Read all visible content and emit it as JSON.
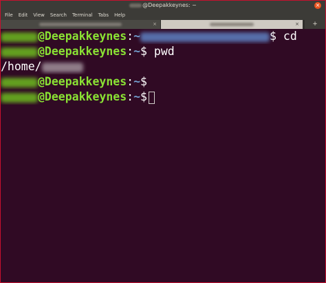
{
  "window": {
    "title_suffix": "@Deepakkeynes: ~",
    "close_glyph": "×"
  },
  "menu": {
    "items": [
      "File",
      "Edit",
      "View",
      "Search",
      "Terminal",
      "Tabs",
      "Help"
    ]
  },
  "tabs": {
    "close_glyph": "×",
    "new_glyph": "+"
  },
  "terminal": {
    "host": "@Deepakkeynes",
    "sep": ":",
    "tilde": "~",
    "dollar": "$",
    "line1_cmd": " cd",
    "line2_cmd": " pwd",
    "line3_output": "/home/"
  },
  "colors": {
    "background": "#300a24",
    "user_green": "#8ae234",
    "path_blue": "#729fcf",
    "text": "#ffffff"
  }
}
